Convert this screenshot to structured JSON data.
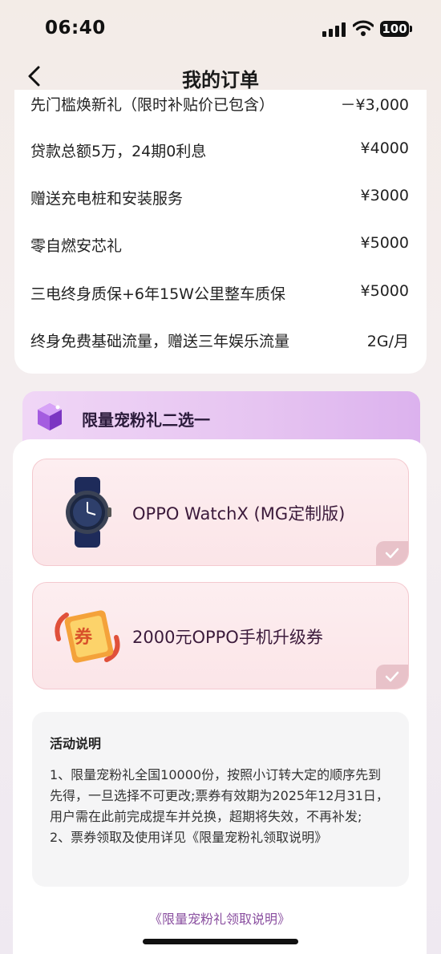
{
  "status_bar": {
    "time": "06:40",
    "battery": "100"
  },
  "nav": {
    "title": "我的订单"
  },
  "benefits": [
    {
      "label": "先门槛焕新礼（限时补贴价已包含）",
      "value": "－¥3,000"
    },
    {
      "label": "贷款总额5万，24期0利息",
      "value": "¥4000"
    },
    {
      "label": "赠送充电桩和安装服务",
      "value": "¥3000"
    },
    {
      "label": "零自燃安芯礼",
      "value": "¥5000"
    },
    {
      "label": "三电终身质保+6年15W公里整车质保",
      "value": "¥5000"
    },
    {
      "label": "终身免费基础流量，赠送三年娱乐流量",
      "value": "2G/月"
    }
  ],
  "gift_section": {
    "title": "限量宠粉礼二选一",
    "options": [
      {
        "label": "OPPO WatchX (MG定制版)",
        "icon": "smartwatch-icon"
      },
      {
        "label": "2000元OPPO手机升级券",
        "icon": "coupon-icon"
      }
    ],
    "coupon_char": "券"
  },
  "notes": {
    "title": "活动说明",
    "line1": "1、限量宠粉礼全国10000份，按照小订转大定的顺序先到先得，一旦选择不可更改;票券有效期为2025年12月31日，用户需在此前完成提车并兑换，超期将失效，不再补发;",
    "line2": "2、票券领取及使用详见《限量宠粉礼领取说明》"
  },
  "rules_link": "《限量宠粉礼领取说明》",
  "colors": {
    "accent": "#8a4fa0",
    "option_bg": "#fbe5e8",
    "header_bg": "#e6c4f1"
  }
}
